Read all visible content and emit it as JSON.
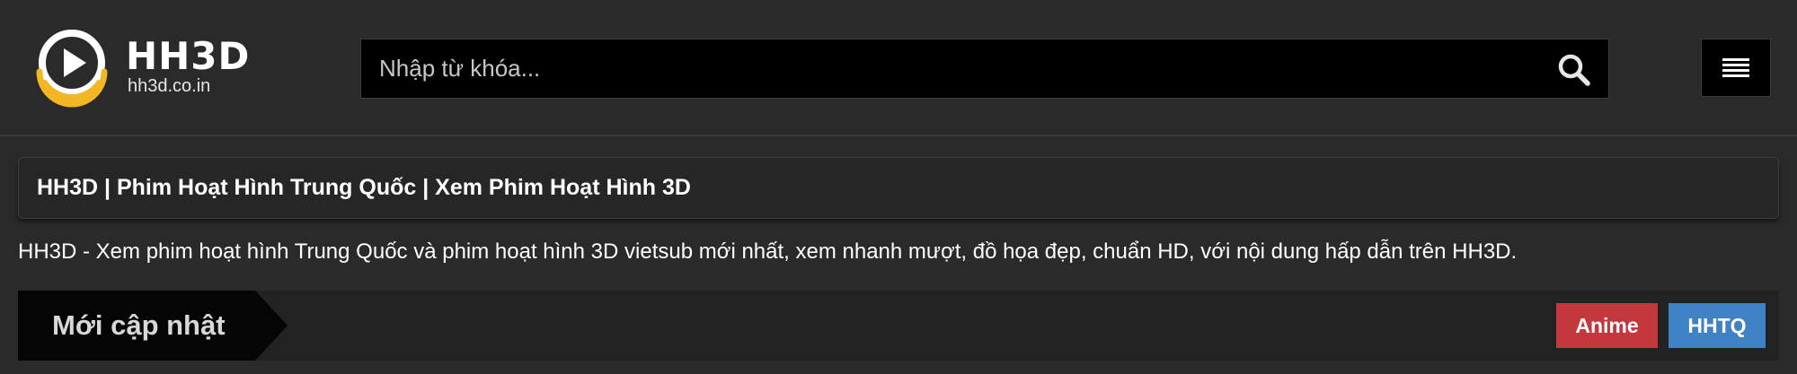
{
  "header": {
    "logo": {
      "title": "HH3D",
      "subtitle": "hh3d.co.in",
      "colors": {
        "ring": "#ffffff",
        "accent": "#f2b824"
      }
    },
    "search": {
      "placeholder": "Nhập từ khóa...",
      "value": "",
      "icon": "search-icon"
    },
    "menu": {
      "icon": "hamburger-menu-icon"
    }
  },
  "main": {
    "page_title": "HH3D | Phim Hoạt Hình Trung Quốc | Xem Phim Hoạt Hình 3D",
    "description": "HH3D - Xem phim hoạt hình Trung Quốc và phim hoạt hình 3D vietsub mới nhất, xem nhanh mượt, đồ họa đẹp, chuẩn HD, với nội dung hấp dẫn trên HH3D.",
    "section": {
      "title": "Mới cập nhật",
      "filters": [
        {
          "label": "Anime",
          "color": "#c4383d"
        },
        {
          "label": "HHTQ",
          "color": "#3f82c6"
        }
      ]
    }
  }
}
